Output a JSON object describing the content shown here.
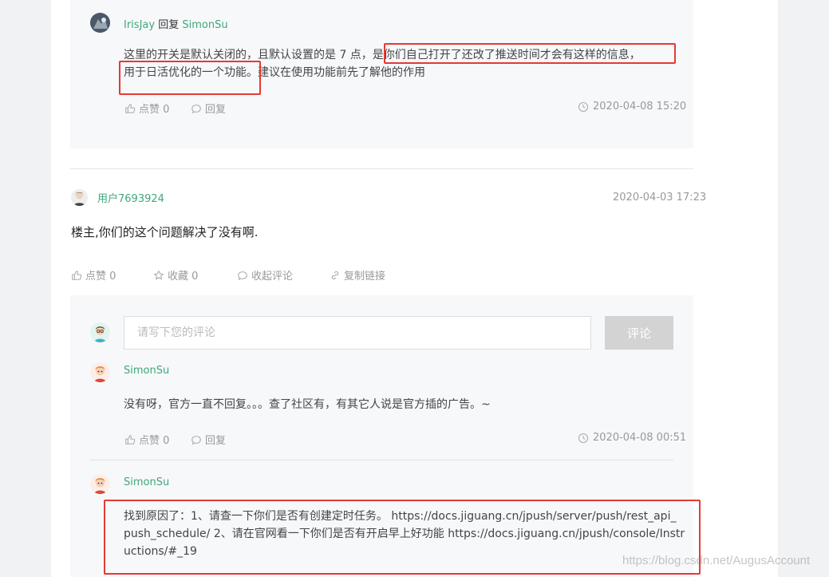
{
  "reply1": {
    "author": "IrisJay",
    "reply_word": "回复",
    "target": "SimonSu",
    "line1_a": "这里的开关是默认关闭的，且默认设置的是 7 点，",
    "line1_b": "是你们自己打开了还改了推送时间才会有这样的信息，",
    "line2_a": "用于日活优化的一个功能。",
    "line2_b": "建议在使用功能前先了解他的作用",
    "like_label": "点赞 0",
    "reply_label": "回复",
    "time": "2020-04-08 15:20"
  },
  "comment": {
    "author": "用户7693924",
    "time": "2020-04-03 17:23",
    "text": "楼主,你们的这个问题解决了没有啊.",
    "like_label": "点赞 0",
    "fav_label": "收藏 0",
    "collapse_label": "收起评论",
    "copy_label": "复制链接"
  },
  "composer": {
    "placeholder": "请写下您的评论",
    "submit_label": "评论"
  },
  "reply2": {
    "author": "SimonSu",
    "text": "没有呀，官方一直不回复。。。查了社区有，有其它人说是官方插的广告。~",
    "like_label": "点赞 0",
    "reply_label": "回复",
    "time": "2020-04-08 00:51"
  },
  "reply3": {
    "author": "SimonSu",
    "line1": "找到原因了：1、请查一下你们是否有创建定时任务。 https://docs.jiguang.cn/jpush/server/push/rest_api_",
    "line2": "push_schedule/ 2、请在官网看一下你们是否有开启早上好功能 https://docs.jiguang.cn/jpush/console/Instr",
    "line3": "uctions/#_19"
  },
  "watermark": "https://blog.csdn.net/AugusAccount",
  "colors": {
    "username": "#3ea87a",
    "highlight_box": "#e53935",
    "submit_button": "#d3d3d3"
  },
  "icons": [
    "thumbs-up-icon",
    "speech-bubble-icon",
    "clock-icon",
    "star-icon",
    "link-icon"
  ]
}
